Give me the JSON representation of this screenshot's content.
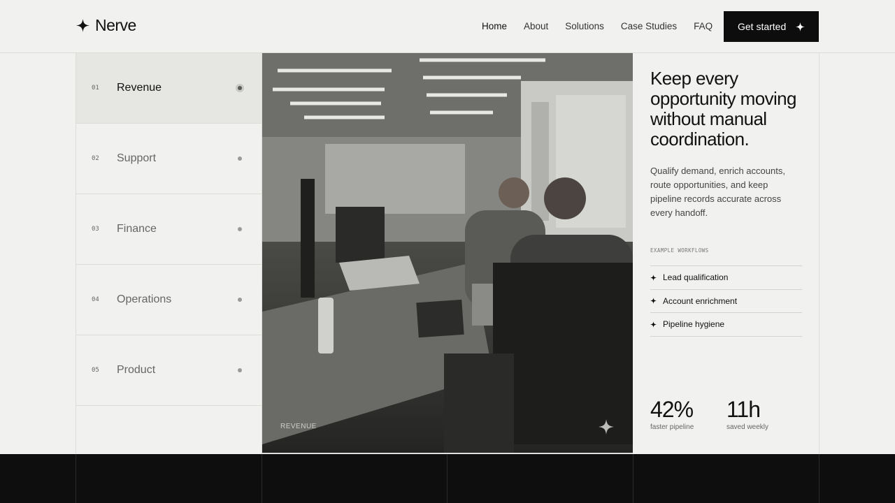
{
  "brand": {
    "name": "Nerve",
    "icon": "sparkle-icon"
  },
  "nav": {
    "items": [
      {
        "label": "Home",
        "active": true
      },
      {
        "label": "About",
        "active": false
      },
      {
        "label": "Solutions",
        "active": false
      },
      {
        "label": "Case Studies",
        "active": false
      },
      {
        "label": "FAQ",
        "active": false
      }
    ],
    "cta_label": "Get started"
  },
  "sidebar": {
    "items": [
      {
        "num": "01",
        "label": "Revenue",
        "active": true
      },
      {
        "num": "02",
        "label": "Support",
        "active": false
      },
      {
        "num": "03",
        "label": "Finance",
        "active": false
      },
      {
        "num": "04",
        "label": "Operations",
        "active": false
      },
      {
        "num": "05",
        "label": "Product",
        "active": false
      }
    ]
  },
  "photo": {
    "caption": "Revenue"
  },
  "panel": {
    "heading": "Keep every opportunity moving without manual coordination.",
    "description": "Qualify demand, enrich accounts, route opportunities, and keep pipeline records accurate across every handoff.",
    "workflows_title": "EXAMPLE WORKFLOWS",
    "workflows": [
      "Lead qualification",
      "Account enrichment",
      "Pipeline hygiene"
    ],
    "stats": [
      {
        "value": "42%",
        "label": "faster pipeline"
      },
      {
        "value": "11h",
        "label": "saved weekly"
      }
    ]
  },
  "colors": {
    "accent": "#0d0d0d",
    "background": "#f1f1ef",
    "footer": "#0e0e0f"
  }
}
